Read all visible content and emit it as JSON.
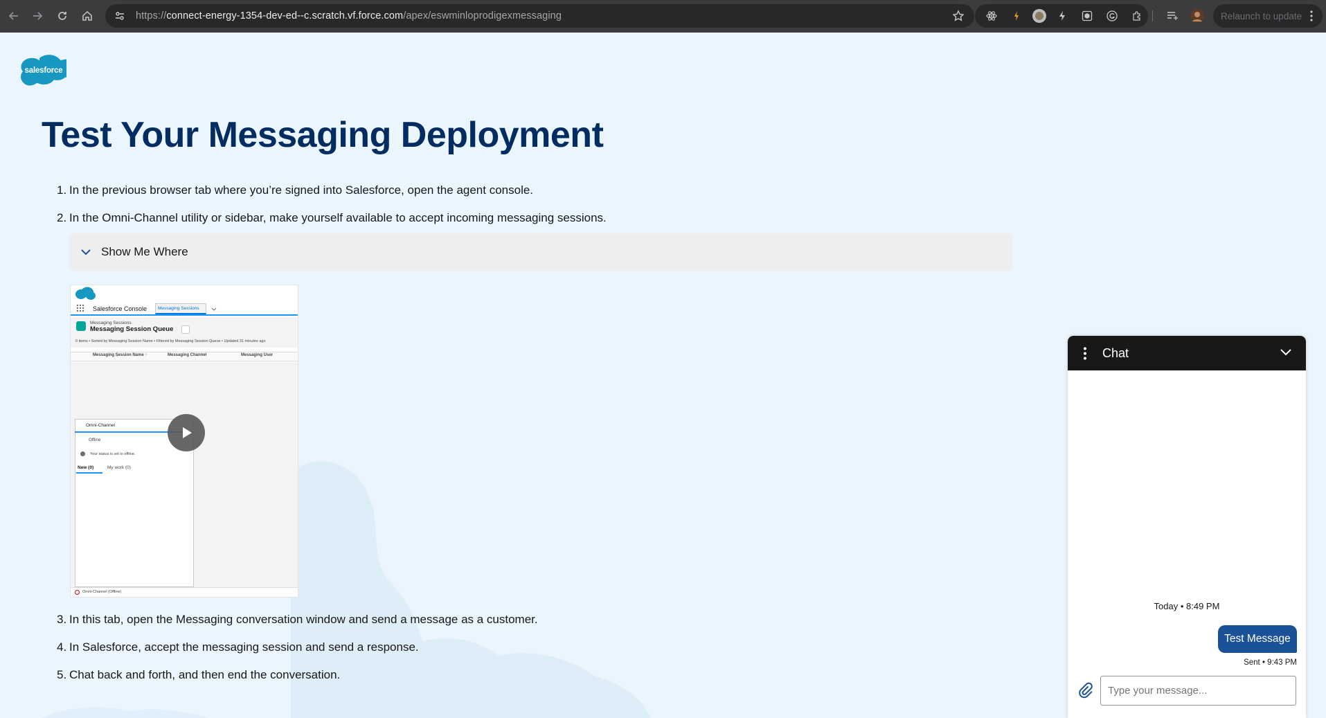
{
  "browser": {
    "url_prefix": "https://",
    "url_host": "connect-energy-1354-dev-ed--c.scratch.vf.force.com",
    "url_path": "/apex/eswminloprodigexmessaging",
    "relaunch_label": "Relaunch to update"
  },
  "page": {
    "logo_text": "salesforce",
    "title": "Test Your Messaging Deployment",
    "steps": [
      {
        "num": "1.",
        "text": "In the previous browser tab where you’re signed into Salesforce, open the agent console."
      },
      {
        "num": "2.",
        "text": "In the Omni-Channel utility or sidebar, make yourself available to accept incoming messaging sessions."
      },
      {
        "num": "3.",
        "text": "In this tab, open the Messaging conversation window and send a message as a customer."
      },
      {
        "num": "4.",
        "text": "In Salesforce, accept the messaging session and send a response."
      },
      {
        "num": "5.",
        "text": "Chat back and forth, and then end the conversation."
      }
    ],
    "accordion_label": "Show Me Where"
  },
  "video": {
    "app_name": "Salesforce Console",
    "tab_label": "Messaging Sessions",
    "object_label": "Messaging Sessions",
    "list_name": "Messaging Session Queue",
    "meta": "0 items • Sorted by Messaging Session Name • Filtered by Messaging Session Queue • Updated 31 minutes ago",
    "col1": "Messaging Session Name ↑",
    "col2": "Messaging Channel",
    "col3": "Messaging User",
    "omni_title": "Omni-Channel",
    "offline": "Offline",
    "status_msg": "Your status is set to offline.",
    "new_tab": "New (0)",
    "mywork_tab": "My work (0)",
    "footer": "Omni-Channel (Offline)"
  },
  "chat": {
    "title": "Chat",
    "timestamp": "Today • 8:49 PM",
    "message": "Test Message",
    "sent": "Sent • 9:43 PM",
    "input_placeholder": "Type your message..."
  },
  "colors": {
    "title_navy": "#032d60",
    "page_bg": "#eaf5fe",
    "bubble": "#1b5297",
    "chat_header": "#181818"
  }
}
